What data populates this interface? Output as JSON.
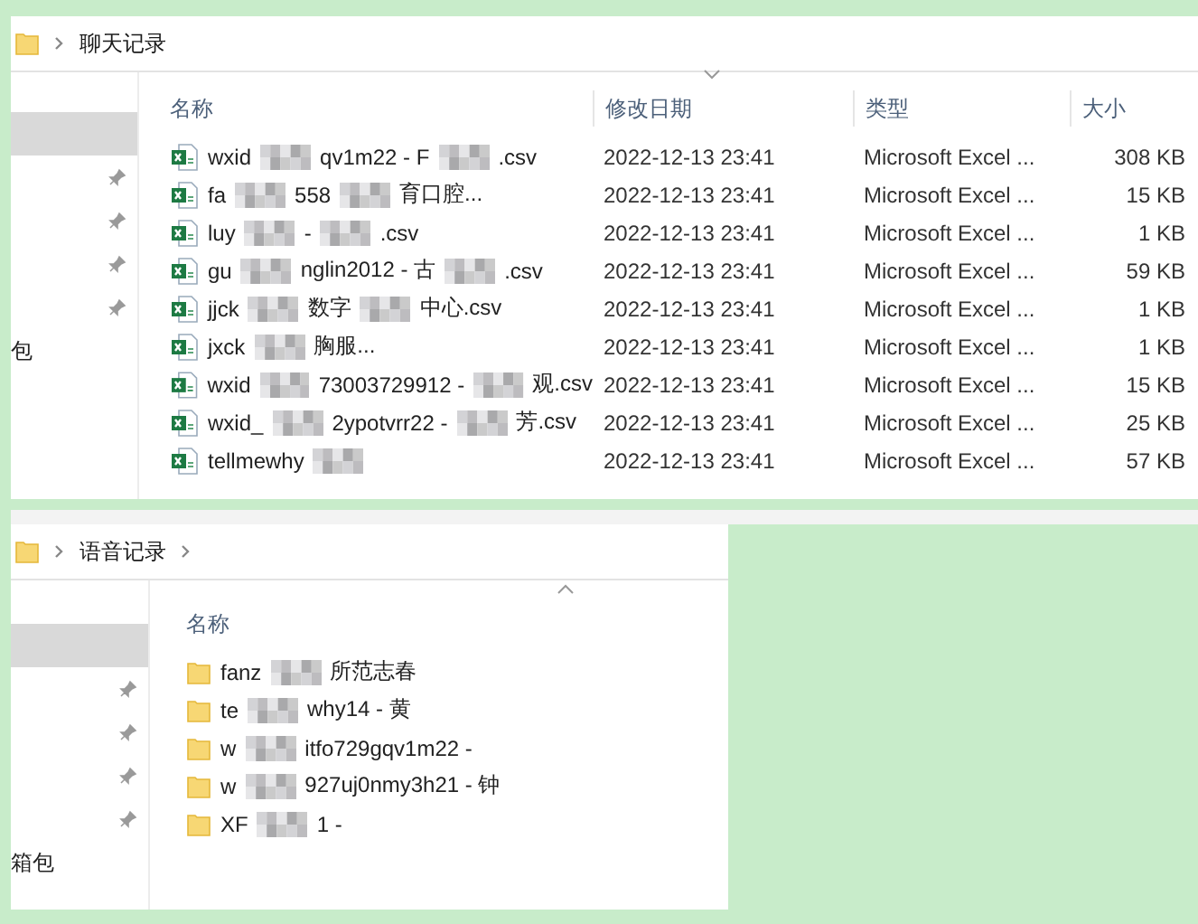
{
  "windows": [
    {
      "breadcrumb": [
        {
          "label": "聊天记录"
        }
      ],
      "trailing_chevron": false,
      "sidebar": [
        {
          "kind": "selected"
        },
        {
          "kind": "pinned"
        },
        {
          "kind": "pinned"
        },
        {
          "kind": "pinned"
        },
        {
          "kind": "pinned"
        },
        {
          "kind": "label",
          "label": "包"
        }
      ],
      "columns": [
        {
          "label": "名称",
          "sorted": false
        },
        {
          "label": "修改日期",
          "sorted": true,
          "descending": true
        },
        {
          "label": "类型",
          "sorted": false
        },
        {
          "label": "大小",
          "sorted": false
        }
      ],
      "rows": [
        {
          "kind": "excel",
          "parts": [
            "wxid",
            "qv1m22 - F",
            ".csv"
          ],
          "modified": "2022-12-13 23:41",
          "type": "Microsoft Excel ...",
          "size": "308 KB"
        },
        {
          "kind": "excel",
          "parts": [
            "fa",
            "558",
            "育口腔..."
          ],
          "modified": "2022-12-13 23:41",
          "type": "Microsoft Excel ...",
          "size": "15 KB"
        },
        {
          "kind": "excel",
          "parts": [
            "luy",
            "-",
            ".csv"
          ],
          "modified": "2022-12-13 23:41",
          "type": "Microsoft Excel ...",
          "size": "1 KB"
        },
        {
          "kind": "excel",
          "parts": [
            "gu",
            "nglin2012 - 古",
            ".csv"
          ],
          "modified": "2022-12-13 23:41",
          "type": "Microsoft Excel ...",
          "size": "59 KB"
        },
        {
          "kind": "excel",
          "parts": [
            "jjck",
            "数字",
            "中心.csv"
          ],
          "modified": "2022-12-13 23:41",
          "type": "Microsoft Excel ...",
          "size": "1 KB"
        },
        {
          "kind": "excel",
          "parts": [
            "jxck",
            "胸服..."
          ],
          "modified": "2022-12-13 23:41",
          "type": "Microsoft Excel ...",
          "size": "1 KB"
        },
        {
          "kind": "excel",
          "parts": [
            "wxid",
            "73003729912 -",
            "观.csv"
          ],
          "modified": "2022-12-13 23:41",
          "type": "Microsoft Excel ...",
          "size": "15 KB"
        },
        {
          "kind": "excel",
          "parts": [
            "wxid_",
            "2ypotvrr22 -",
            "芳.csv"
          ],
          "modified": "2022-12-13 23:41",
          "type": "Microsoft Excel ...",
          "size": "25 KB"
        },
        {
          "kind": "excel",
          "parts": [
            "tellmewhy"
          ],
          "modified": "2022-12-13 23:41",
          "type": "Microsoft Excel ...",
          "size": "57 KB"
        }
      ]
    },
    {
      "breadcrumb": [
        {
          "label": "语音记录"
        }
      ],
      "trailing_chevron": true,
      "sidebar": [
        {
          "kind": "selected"
        },
        {
          "kind": "pinned"
        },
        {
          "kind": "pinned"
        },
        {
          "kind": "pinned"
        },
        {
          "kind": "pinned"
        },
        {
          "kind": "label",
          "label": "箱包"
        }
      ],
      "columns": [
        {
          "label": "名称",
          "sorted": true,
          "descending": false
        }
      ],
      "rows": [
        {
          "kind": "folder",
          "parts": [
            "fanz",
            "所范志春"
          ]
        },
        {
          "kind": "folder",
          "parts": [
            "te",
            "why14 - 黄"
          ]
        },
        {
          "kind": "folder",
          "parts": [
            "w",
            "itfo729gqv1m22 -"
          ]
        },
        {
          "kind": "folder",
          "parts": [
            "w",
            "927uj0nmy3h21 - 钟"
          ]
        },
        {
          "kind": "folder",
          "parts": [
            "XF",
            "1 -"
          ]
        }
      ]
    }
  ]
}
